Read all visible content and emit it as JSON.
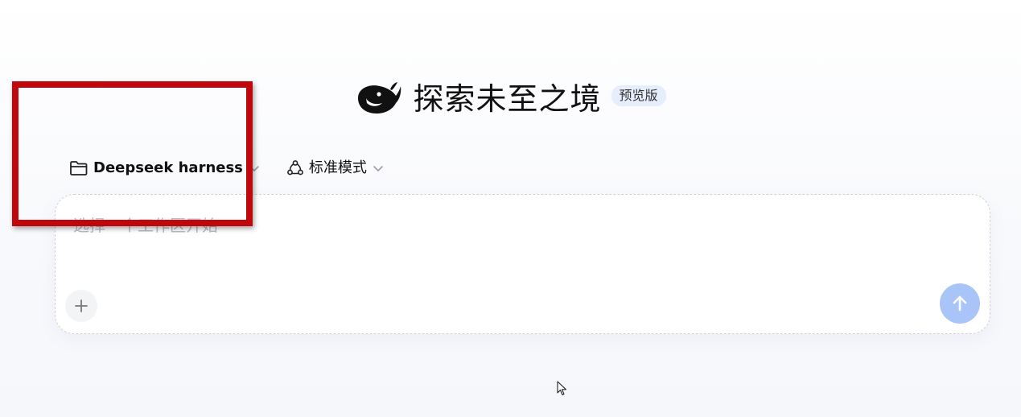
{
  "header": {
    "logo_icon": "whale-icon",
    "title": "探索未至之境",
    "badge": "预览版"
  },
  "toolbar": {
    "workspace": {
      "icon": "folder-icon",
      "label": "Deepseek harness",
      "chevron": "chevron-down-icon"
    },
    "mode": {
      "icon": "cycle-icon",
      "label": "标准模式",
      "chevron": "chevron-down-icon"
    }
  },
  "composer": {
    "placeholder": "选择一个工作区开始",
    "value": "",
    "add_icon": "plus-icon",
    "send_icon": "arrow-up-icon"
  },
  "colors": {
    "annotation": "#c0070b",
    "send_button": "#a9c5f8",
    "badge_bg": "#e6eefc"
  }
}
